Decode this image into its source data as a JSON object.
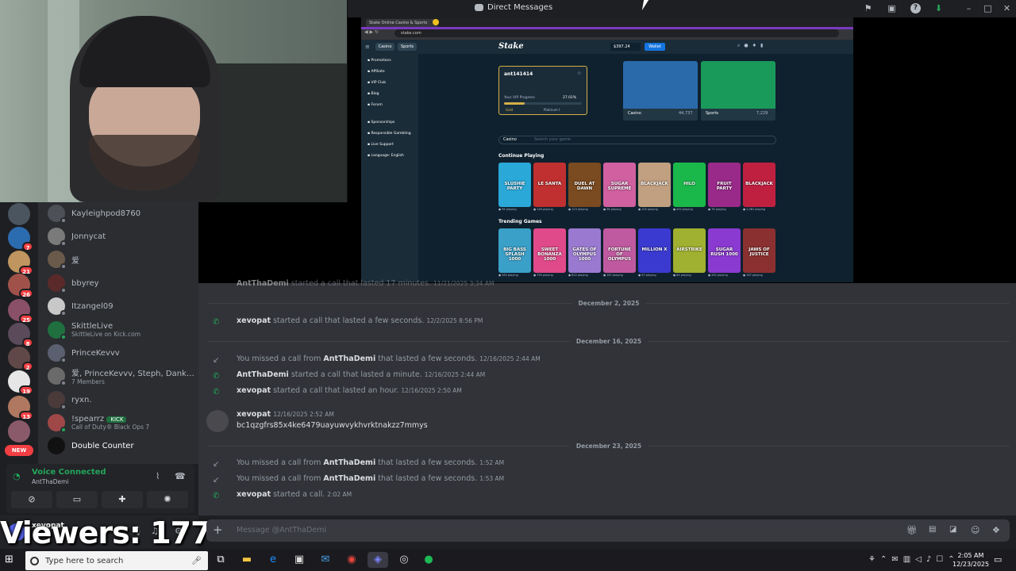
{
  "window": {
    "title": "Direct Messages"
  },
  "servers": [
    {
      "color": "#4a5560",
      "badge": ""
    },
    {
      "color": "#2b6cb0",
      "badge": "7"
    },
    {
      "color": "#c0955f",
      "badge": "21"
    },
    {
      "color": "#a0524a",
      "badge": "26"
    },
    {
      "color": "#8a5068",
      "badge": "25"
    },
    {
      "color": "#5a4a5a",
      "badge": "8"
    },
    {
      "color": "#604848",
      "badge": "2"
    },
    {
      "color": "#e6e6e6",
      "badge": "19"
    },
    {
      "color": "#b07860",
      "badge": "13"
    },
    {
      "color": "#8a5a6a",
      "badge": ""
    }
  ],
  "new_badge": "NEW",
  "dms": [
    {
      "name": "Kayleighpod8760",
      "sub": "",
      "color": "#4e5058",
      "online": false
    },
    {
      "name": "Jonnycat",
      "sub": "",
      "color": "#7a7a7a",
      "online": false
    },
    {
      "name": "爱",
      "sub": "",
      "color": "#6a5a4a",
      "online": false
    },
    {
      "name": "bbyrey",
      "sub": "",
      "color": "#5a2a2a",
      "online": false
    },
    {
      "name": "Itzangel09",
      "sub": "",
      "color": "#c8c8c8",
      "online": false
    },
    {
      "name": "SkittleLive",
      "sub": "SkittleLive on Kick.com",
      "color": "#1f6f3f",
      "online": true
    },
    {
      "name": "PrinceKevvv",
      "sub": "",
      "color": "#5a6070",
      "online": false
    },
    {
      "name": "爱, PrinceKevvv, Steph, Dank, ...",
      "sub": "7 Members",
      "color": "#6a6a6a",
      "online": false
    },
    {
      "name": "ryxn.",
      "sub": "",
      "color": "#4a3a3a",
      "online": false
    },
    {
      "name": "!spearrz",
      "sub": "Call of Duty® Black Ops 7",
      "color": "#a04848",
      "online": true,
      "tag": "KICK"
    },
    {
      "name": "Double Counter",
      "sub": "",
      "color": "#111111",
      "online": false,
      "bold": true
    }
  ],
  "voice": {
    "status": "Voice Connected",
    "channel": "AntThaDemi"
  },
  "user": {
    "name": "xevopat"
  },
  "overlay": {
    "viewers": "Viewers: 177"
  },
  "chat": {
    "cut_message": {
      "author": "AntThaDemi",
      "text": "started a call that lasted 17 minutes.",
      "time": "11/21/2025 3:34 AM"
    },
    "dividers": [
      "December 2, 2025",
      "December 16, 2025",
      "December 23, 2025"
    ],
    "messages": [
      {
        "kind": "call",
        "author": "xevopat",
        "text": "started a call that lasted a few seconds.",
        "time": "12/2/2025 8:56 PM"
      },
      {
        "kind": "missed",
        "pre": "You missed a call from",
        "author": "AntThaDemi",
        "text": "that lasted a few seconds.",
        "time": "12/16/2025 2:44 AM"
      },
      {
        "kind": "call",
        "author": "AntThaDemi",
        "text": "started a call that lasted a minute.",
        "time": "12/16/2025 2:44 AM"
      },
      {
        "kind": "call",
        "author": "xevopat",
        "text": "started a call that lasted an hour.",
        "time": "12/16/2025 2:50 AM"
      },
      {
        "kind": "text",
        "author": "xevopat",
        "time": "12/16/2025 2:52 AM",
        "text": "bc1qzgfrs85x4ke6479uayuwvykhvrktnakzz7mmys"
      },
      {
        "kind": "missed",
        "pre": "You missed a call from",
        "author": "AntThaDemi",
        "text": "that lasted a few seconds.",
        "time": "1:52 AM"
      },
      {
        "kind": "missed",
        "pre": "You missed a call from",
        "author": "AntThaDemi",
        "text": "that lasted a few seconds.",
        "time": "1:53 AM"
      },
      {
        "kind": "call",
        "author": "xevopat",
        "text": "started a call.",
        "time": "2:02 AM"
      }
    ],
    "input_placeholder": "Message @AntThaDemi"
  },
  "stake": {
    "tab_title": "Stake Online Casino & Sports",
    "url": "stake.com",
    "nav_casino": "Casino",
    "nav_sports": "Sports",
    "logo": "Stake",
    "balance": "$397.24",
    "wallet": "Wallet",
    "sidebar": [
      "Promotions",
      "Affiliate",
      "VIP Club",
      "Blog",
      "Forum",
      "Sponsorships",
      "Responsible Gambling",
      "Live Support",
      "Language: English"
    ],
    "username": "ant141414",
    "vip_label": "Your VIP Progress",
    "vip_pct": "27.01%",
    "vip_progress": 0.27,
    "vip_from": "Gold",
    "vip_to": "Platinum I",
    "casino_card": {
      "label": "Casino",
      "count": "44,737"
    },
    "sports_card": {
      "label": "Sports",
      "count": "7,229"
    },
    "search_select": "Casino",
    "search_placeholder": "Search your game",
    "section1": "Continue Playing",
    "section2": "Trending Games",
    "row1": [
      {
        "title": "SLUSHIE PARTY",
        "color": "#2aa8d8",
        "players": "96 playing"
      },
      {
        "title": "LE SANTA",
        "color": "#c03030",
        "players": "146 playing"
      },
      {
        "title": "DUEL AT DAWN",
        "color": "#7a4a20",
        "players": "123 playing"
      },
      {
        "title": "SUGAR SUPREME",
        "color": "#d060a0",
        "players": "38 playing"
      },
      {
        "title": "BLACKJACK",
        "color": "#c0a080",
        "players": "105 playing"
      },
      {
        "title": "HILO",
        "color": "#1ab84a",
        "players": "452 playing"
      },
      {
        "title": "FRUIT PARTY",
        "color": "#9a2a8a",
        "players": "78 playing"
      },
      {
        "title": "BLACKJACK",
        "color": "#c02040",
        "players": "1,081 playing"
      }
    ],
    "row2": [
      {
        "title": "BIG BASS SPLASH 1000",
        "color": "#3aa0c8",
        "players": "283 playing"
      },
      {
        "title": "SWEET BONANZA 1000",
        "color": "#e04a8a",
        "players": "790 playing"
      },
      {
        "title": "GATES OF OLYMPUS 1000",
        "color": "#9a7ad0",
        "players": "622 playing"
      },
      {
        "title": "FORTUNE OF OLYMPUS",
        "color": "#c05aa0",
        "players": "167 playing"
      },
      {
        "title": "MILLION X",
        "color": "#3a3ad0",
        "players": "53 playing"
      },
      {
        "title": "AIRSTRIKE",
        "color": "#a0b030",
        "players": "84 playing"
      },
      {
        "title": "SUGAR RUSH 1000",
        "color": "#8a3ad0",
        "players": "452 playing"
      },
      {
        "title": "JAWS OF JUSTICE",
        "color": "#8a3030",
        "players": "187 playing"
      }
    ]
  },
  "taskbar": {
    "search": "Type here to search",
    "time": "2:05 AM",
    "date": "12/23/2025"
  }
}
